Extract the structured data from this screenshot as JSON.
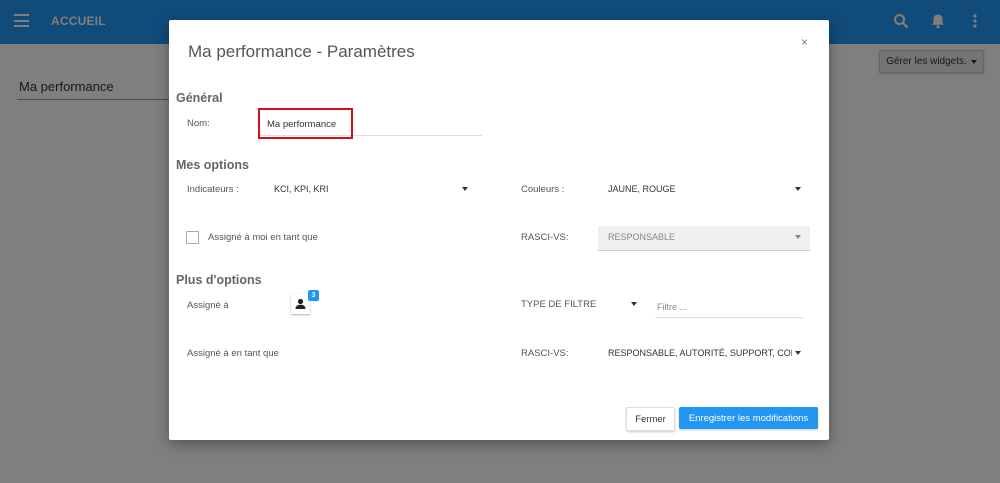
{
  "topbar": {
    "title": "ACCUEIL",
    "color": "#2196f3",
    "icons": [
      "menu-icon",
      "search-icon",
      "bell-icon",
      "more-vert-icon"
    ]
  },
  "page": {
    "heading": "Ma performance",
    "widgets_button": "Gérer les widgets."
  },
  "modal": {
    "title": "Ma performance - Paramètres",
    "close_label": "×",
    "general": {
      "heading": "Général",
      "name_label": "Nom:",
      "name_value": "Ma performance"
    },
    "my_options": {
      "heading": "Mes options",
      "indicators_label": "Indicateurs :",
      "indicators_value": "KCI, KPI, KRI",
      "colors_label": "Couleurs :",
      "colors_value": "JAUNE, ROUGE",
      "assigned_me_label": "Assigné à moi en tant que",
      "assigned_me_checked": false,
      "rasci_label": "RASCI-VS:",
      "rasci_value": "RESPONSABLE"
    },
    "more_options": {
      "heading": "Plus d'options",
      "assigned_to_label": "Assigné à",
      "assigned_count": "3",
      "filter_type_label": "TYPE DE FILTRE",
      "filter_placeholder": "Filtre ...",
      "assigned_as_label": "Assigné à en tant que",
      "rasci_label": "RASCI-VS:",
      "rasci_value": "RESPONSABLE, AUTORITÉ, SUPPORT, CONS"
    },
    "buttons": {
      "close": "Fermer",
      "save": "Enregistrer les modifications"
    },
    "accent_color": "#2196f3",
    "highlight_color": "#d0101b"
  }
}
